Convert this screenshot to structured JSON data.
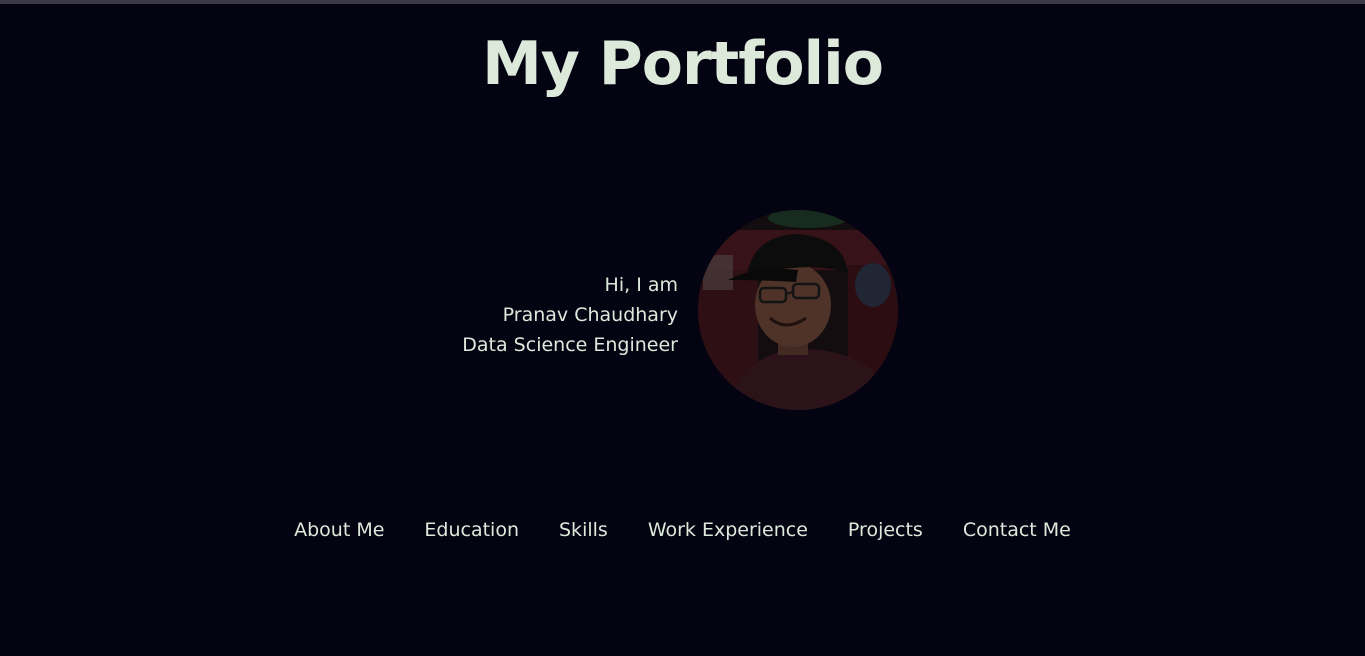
{
  "header": {
    "title": "My Portfolio"
  },
  "intro": {
    "greeting": "Hi, I am",
    "name": "Pranav Chaudhary",
    "role": "Data Science Engineer"
  },
  "profile_photo": {
    "alt": "Pranav Chaudhary"
  },
  "nav": {
    "items": [
      {
        "label": "About Me"
      },
      {
        "label": "Education"
      },
      {
        "label": "Skills"
      },
      {
        "label": "Work Experience"
      },
      {
        "label": "Projects"
      },
      {
        "label": "Contact Me"
      }
    ]
  },
  "colors": {
    "background": "#040312",
    "text": "#dde9da"
  }
}
